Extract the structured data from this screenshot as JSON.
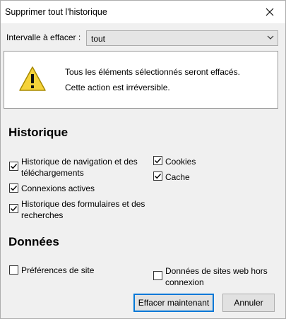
{
  "window": {
    "title": "Supprimer tout l'historique"
  },
  "range": {
    "label": "Intervalle à effacer :",
    "value": "tout"
  },
  "warning": {
    "line1": "Tous les éléments sélectionnés seront effacés.",
    "line2": "Cette action est irréversible."
  },
  "history": {
    "heading": "Historique",
    "items": [
      {
        "label_1": "Historique de navigation et des",
        "label_2": "téléchargements",
        "checked": true
      },
      {
        "label_1": "Connexions actives",
        "checked": true
      },
      {
        "label_1": "Historique des formulaires et des",
        "label_2": "recherches",
        "checked": true
      },
      {
        "label_1": "Cookies",
        "checked": true
      },
      {
        "label_1": "Cache",
        "checked": true
      }
    ]
  },
  "data_section": {
    "heading": "Données",
    "items": [
      {
        "label_1": "Préférences de site",
        "checked": false
      },
      {
        "label_1": "Données de sites web hors",
        "label_2": "connexion",
        "checked": false
      }
    ]
  },
  "buttons": {
    "confirm": "Effacer maintenant",
    "cancel": "Annuler"
  }
}
